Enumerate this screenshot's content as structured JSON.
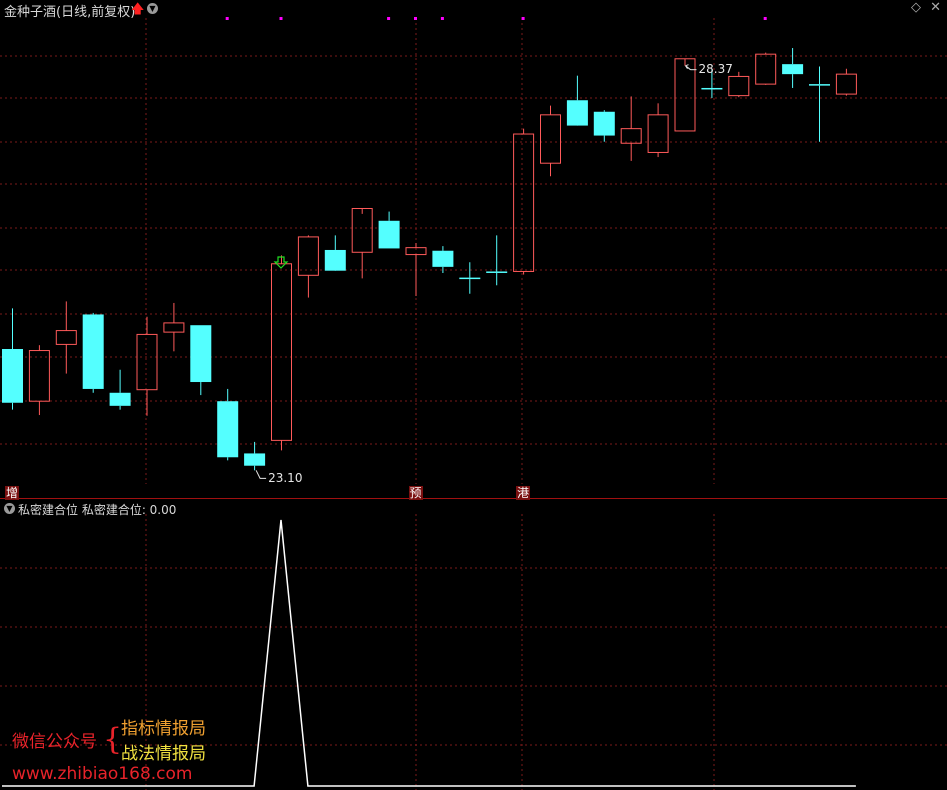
{
  "header": {
    "title": "金种子酒(日线,前复权)",
    "arrow_icon": "red-up-arrow-icon",
    "menu_icon": "chevron-down-icon",
    "diamond_glyph": "◇",
    "close_glyph": "✕"
  },
  "colors": {
    "background": "#000000",
    "up_candle": "#ff5a5a",
    "down_candle": "#54ffff",
    "grid": "#7a1a1a",
    "divider": "#a01010",
    "signal_line": "#ffffff",
    "marker_dot": "#ff00ff",
    "signal_arrow": "#22dd22"
  },
  "chart_data": {
    "type": "candlestick",
    "price_labels": {
      "high": "28.37",
      "low": "23.10"
    },
    "candles": [
      {
        "o": 24.68,
        "h": 25.21,
        "l": 23.89,
        "c": 23.98,
        "dir": "down"
      },
      {
        "o": 24.0,
        "h": 24.73,
        "l": 23.82,
        "c": 24.66,
        "dir": "up"
      },
      {
        "o": 24.74,
        "h": 25.3,
        "l": 24.36,
        "c": 24.92,
        "dir": "up"
      },
      {
        "o": 25.13,
        "h": 25.15,
        "l": 24.11,
        "c": 24.16,
        "dir": "down"
      },
      {
        "o": 24.11,
        "h": 24.41,
        "l": 23.89,
        "c": 23.94,
        "dir": "down"
      },
      {
        "o": 24.15,
        "h": 25.1,
        "l": 23.81,
        "c": 24.87,
        "dir": "up"
      },
      {
        "o": 24.9,
        "h": 25.28,
        "l": 24.65,
        "c": 25.02,
        "dir": "up"
      },
      {
        "o": 24.99,
        "h": 24.99,
        "l": 24.08,
        "c": 24.25,
        "dir": "down"
      },
      {
        "o": 24.0,
        "h": 24.16,
        "l": 23.23,
        "c": 23.27,
        "dir": "down"
      },
      {
        "o": 23.32,
        "h": 23.47,
        "l": 23.1,
        "c": 23.16,
        "dir": "down"
      },
      {
        "o": 23.49,
        "h": 25.9,
        "l": 23.36,
        "c": 25.79,
        "dir": "up"
      },
      {
        "o": 25.64,
        "h": 26.16,
        "l": 25.35,
        "c": 26.14,
        "dir": "up"
      },
      {
        "o": 25.97,
        "h": 26.16,
        "l": 25.8,
        "c": 25.7,
        "dir": "down"
      },
      {
        "o": 25.94,
        "h": 26.44,
        "l": 25.6,
        "c": 26.51,
        "dir": "up"
      },
      {
        "o": 26.35,
        "h": 26.47,
        "l": 25.99,
        "c": 25.99,
        "dir": "down"
      },
      {
        "o": 25.91,
        "h": 26.06,
        "l": 25.37,
        "c": 26.0,
        "dir": "up"
      },
      {
        "o": 25.96,
        "h": 26.02,
        "l": 25.67,
        "c": 25.75,
        "dir": "down"
      },
      {
        "o": 25.61,
        "h": 25.81,
        "l": 25.4,
        "c": 25.61,
        "dir": "down"
      },
      {
        "o": 25.69,
        "h": 26.16,
        "l": 25.51,
        "c": 25.69,
        "dir": "down"
      },
      {
        "o": 25.69,
        "h": 27.55,
        "l": 25.65,
        "c": 27.48,
        "dir": "up"
      },
      {
        "o": 27.1,
        "h": 27.85,
        "l": 26.93,
        "c": 27.73,
        "dir": "up"
      },
      {
        "o": 27.92,
        "h": 28.24,
        "l": 27.75,
        "c": 27.59,
        "dir": "down"
      },
      {
        "o": 27.77,
        "h": 27.79,
        "l": 27.38,
        "c": 27.46,
        "dir": "down"
      },
      {
        "o": 27.36,
        "h": 27.97,
        "l": 27.13,
        "c": 27.55,
        "dir": "up"
      },
      {
        "o": 27.24,
        "h": 27.88,
        "l": 27.18,
        "c": 27.73,
        "dir": "up"
      },
      {
        "o": 27.52,
        "h": 28.37,
        "l": 27.52,
        "c": 28.46,
        "dir": "up"
      },
      {
        "o": 28.08,
        "h": 28.33,
        "l": 27.95,
        "c": 28.08,
        "dir": "down"
      },
      {
        "o": 27.98,
        "h": 28.29,
        "l": 27.96,
        "c": 28.23,
        "dir": "up"
      },
      {
        "o": 28.13,
        "h": 28.54,
        "l": 28.12,
        "c": 28.52,
        "dir": "up"
      },
      {
        "o": 28.39,
        "h": 28.6,
        "l": 28.08,
        "c": 28.26,
        "dir": "down"
      },
      {
        "o": 28.13,
        "h": 28.36,
        "l": 27.38,
        "c": 28.13,
        "dir": "down"
      },
      {
        "o": 28.0,
        "h": 28.33,
        "l": 27.98,
        "c": 28.26,
        "dir": "up"
      }
    ],
    "signal_candle_index": 10,
    "marker_indices": [
      8,
      10,
      14,
      15,
      16,
      19,
      28
    ],
    "events": [
      {
        "label": "增",
        "index": 0
      },
      {
        "label": "预",
        "index": 15
      },
      {
        "label": "港",
        "index": 19
      }
    ],
    "indicator": {
      "name": "私密建合位",
      "title": "私密建合位  私密建合位: 0.00",
      "values": [
        0,
        0,
        0,
        0,
        0,
        0,
        0,
        0,
        0,
        0,
        1,
        0,
        0,
        0,
        0,
        0,
        0,
        0,
        0,
        0,
        0,
        0,
        0,
        0,
        0,
        0,
        0,
        0,
        0,
        0,
        0,
        0
      ],
      "ylim": [
        0,
        1
      ]
    }
  },
  "watermark": {
    "label": "微信公众号",
    "brace": "{",
    "line1": "指标情报局",
    "line2": "战法情报局",
    "url": "www.zhibiao168.com"
  }
}
